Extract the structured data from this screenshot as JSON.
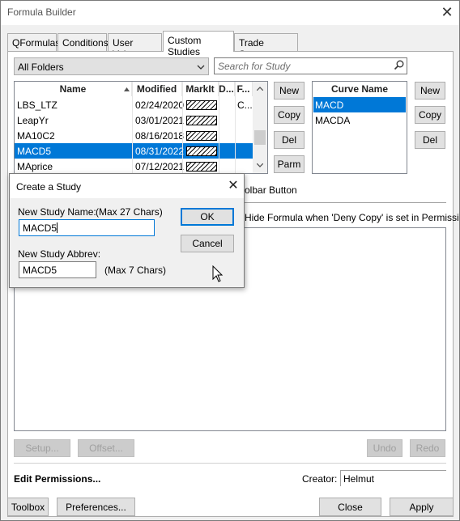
{
  "window": {
    "title": "Formula Builder"
  },
  "tabs": [
    {
      "label": "QFormulas"
    },
    {
      "label": "Conditions"
    },
    {
      "label": "User Values"
    },
    {
      "label": "Custom Studies"
    },
    {
      "label": "Trade Systems"
    }
  ],
  "folder_combo": {
    "value": "All Folders"
  },
  "search": {
    "placeholder": "Search for Study"
  },
  "study_grid": {
    "columns": [
      "Name",
      "Modified",
      "MarkIt",
      "D...",
      "F..."
    ],
    "rows": [
      {
        "name": "LBS_LTZ",
        "modified": "02/24/2020",
        "f": "C..."
      },
      {
        "name": "LeapYr",
        "modified": "03/01/2021",
        "f": ""
      },
      {
        "name": "MA10C2",
        "modified": "08/16/2018",
        "f": ""
      },
      {
        "name": "MACD5",
        "modified": "08/31/2022",
        "f": ""
      },
      {
        "name": "MAprice",
        "modified": "07/12/2021",
        "f": ""
      }
    ],
    "selected": "MACD5"
  },
  "study_buttons": {
    "new": "New",
    "copy": "Copy",
    "del": "Del",
    "parm": "Parm"
  },
  "curve_grid": {
    "header": "Curve Name",
    "rows": [
      "MACD",
      "MACDA"
    ],
    "selected": "MACD"
  },
  "curve_buttons": {
    "new": "New",
    "copy": "Copy",
    "del": "Del"
  },
  "partial_text": {
    "toolbar_button": "olbar Button",
    "hide_formula": "Hide Formula when 'Deny Copy' is set in Permissions"
  },
  "bottom_buttons": {
    "setup": "Setup...",
    "offset": "Offset...",
    "undo": "Undo",
    "redo": "Redo"
  },
  "permissions": {
    "label": "Edit Permissions...",
    "creator_label": "Creator:",
    "creator_value": "Helmut"
  },
  "footer": {
    "toolbox": "Toolbox",
    "preferences": "Preferences...",
    "close": "Close",
    "apply": "Apply"
  },
  "dialog": {
    "title": "Create a Study",
    "name_label": "New Study Name:",
    "name_hint": "(Max 27 Chars)",
    "name_value": "MACD5",
    "abbrev_label": "New Study Abbrev:",
    "abbrev_value": "MACD5",
    "abbrev_hint": "(Max 7 Chars)",
    "ok": "OK",
    "cancel": "Cancel"
  },
  "colors": {
    "selection": "#0078d7",
    "window_bg": "#f0f0f0"
  }
}
